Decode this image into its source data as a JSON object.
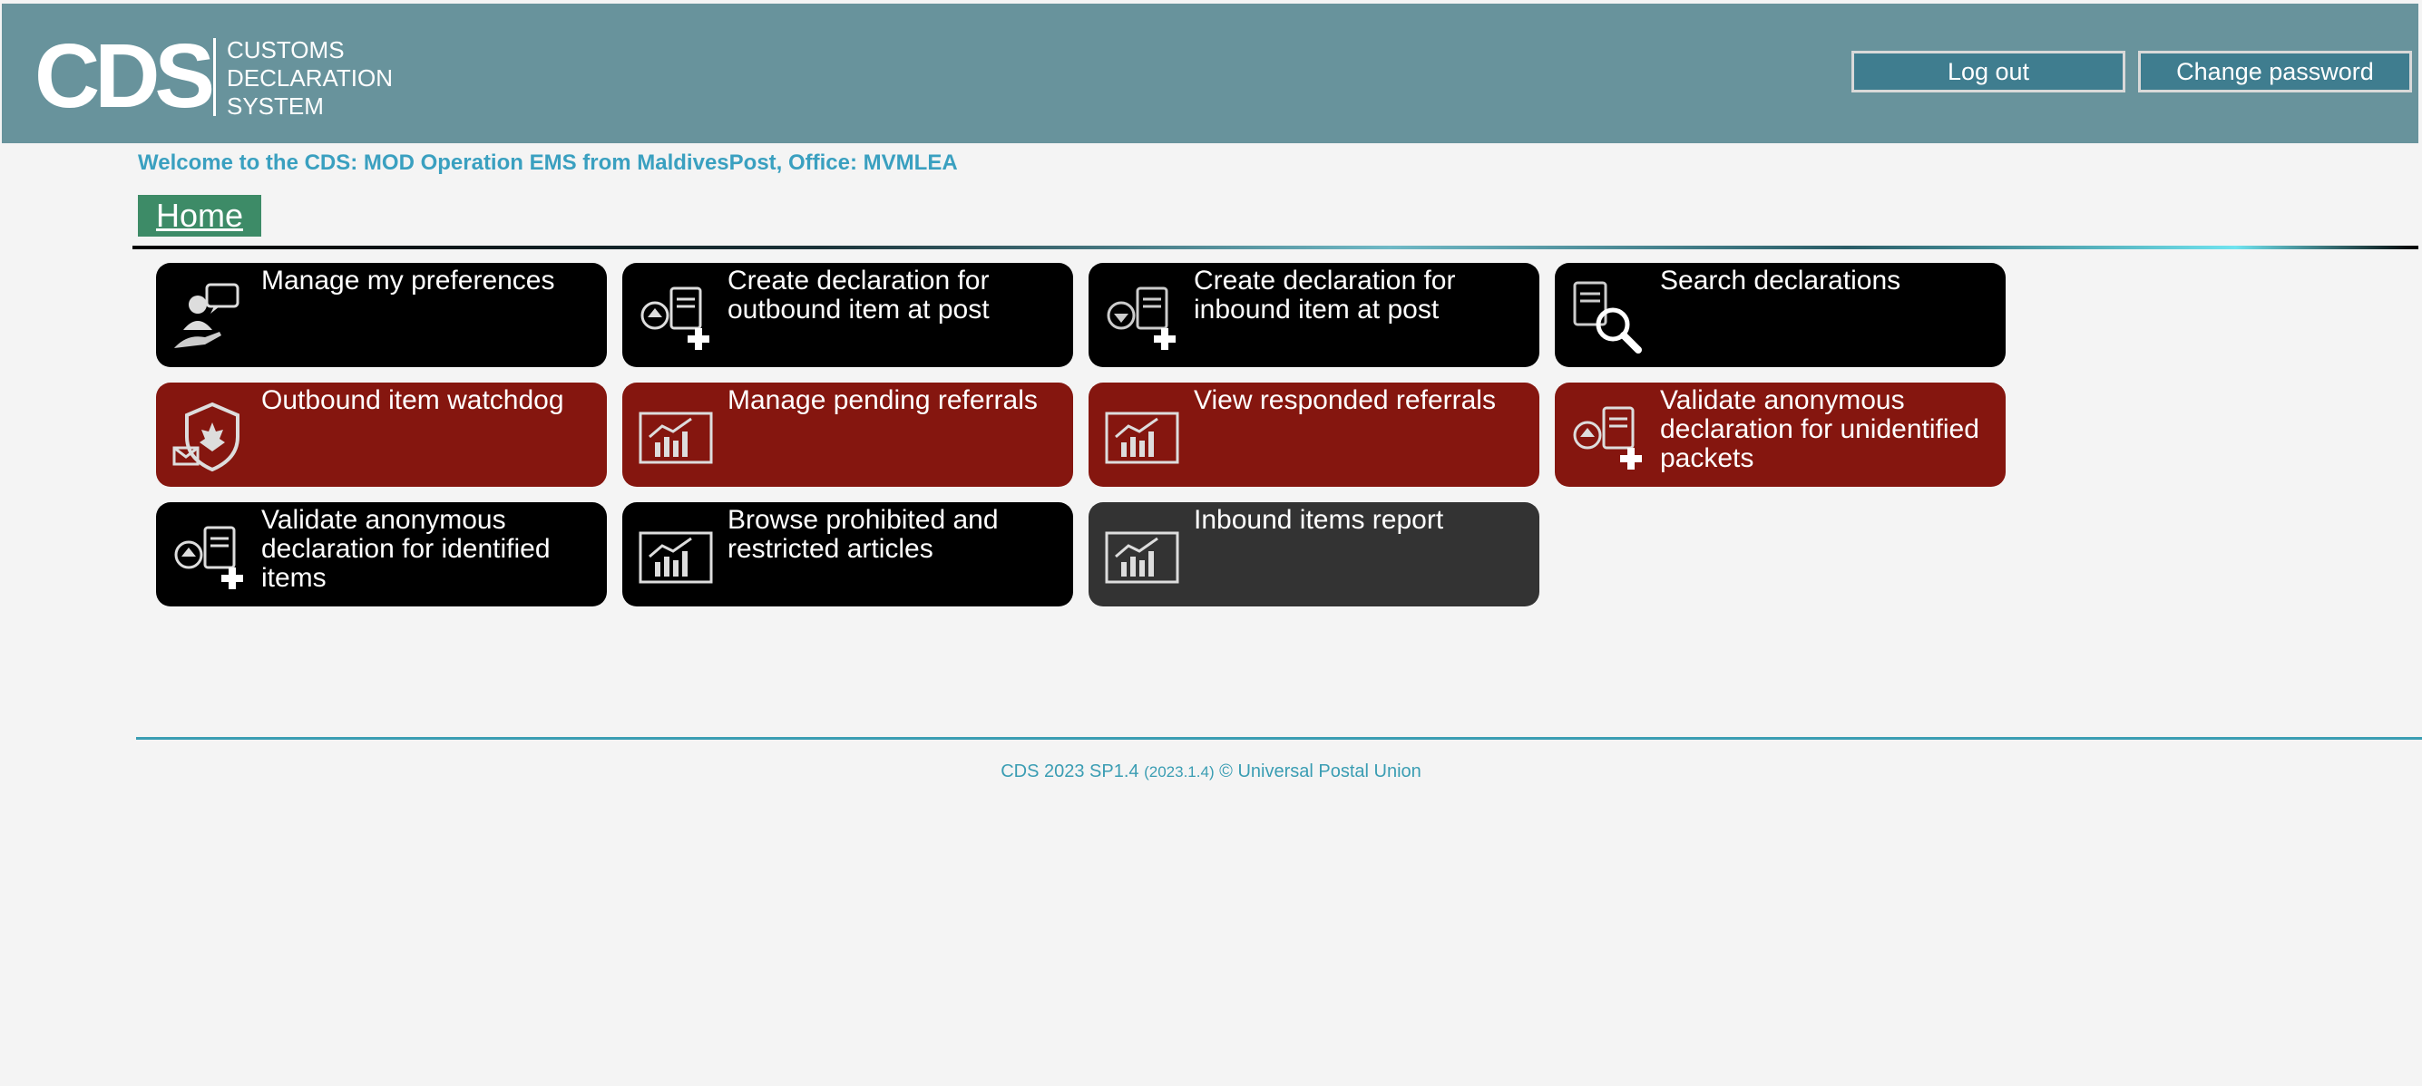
{
  "header": {
    "logo_abbr": "CDS",
    "logo_lines": [
      "CUSTOMS",
      "DECLARATION",
      "SYSTEM"
    ],
    "logout_label": "Log out",
    "change_password_label": "Change password",
    "background_color": "#68939c"
  },
  "welcome_text": "Welcome to the CDS: MOD Operation EMS from MaldivesPost, Office: MVMLEA",
  "home_tab_label": "Home",
  "tiles": [
    {
      "label": "Manage my preferences",
      "color": "black",
      "icon": "user-preferences-icon"
    },
    {
      "label": "Create declaration for outbound item at post",
      "color": "black",
      "icon": "outbound-declaration-icon"
    },
    {
      "label": "Create declaration for inbound item at post",
      "color": "black",
      "icon": "inbound-declaration-icon"
    },
    {
      "label": "Search declarations",
      "color": "black",
      "icon": "search-declarations-icon"
    },
    {
      "label": "Outbound item watchdog",
      "color": "red",
      "icon": "watchdog-shield-icon"
    },
    {
      "label": "Manage pending referrals",
      "color": "red",
      "icon": "chart-report-icon"
    },
    {
      "label": "View responded referrals",
      "color": "red",
      "icon": "chart-report-icon"
    },
    {
      "label": "Validate anonymous declaration for unidentified packets",
      "color": "red",
      "icon": "outbound-declaration-icon"
    },
    {
      "label": "Validate anonymous declaration for identified items",
      "color": "black",
      "icon": "outbound-declaration-icon"
    },
    {
      "label": "Browse prohibited and restricted articles",
      "color": "black",
      "icon": "chart-report-icon"
    },
    {
      "label": "Inbound items report",
      "color": "grey",
      "icon": "chart-report-icon"
    }
  ],
  "colors": {
    "tile_black": "#000000",
    "tile_red": "#85160f",
    "tile_grey": "#333333",
    "accent_blue": "#3a9db3",
    "home_green": "#3d8b67"
  },
  "footer": {
    "version_text": "CDS 2023 SP1.4",
    "build_text": "(2023.1.4)",
    "copyright_text": "© Universal Postal Union"
  }
}
